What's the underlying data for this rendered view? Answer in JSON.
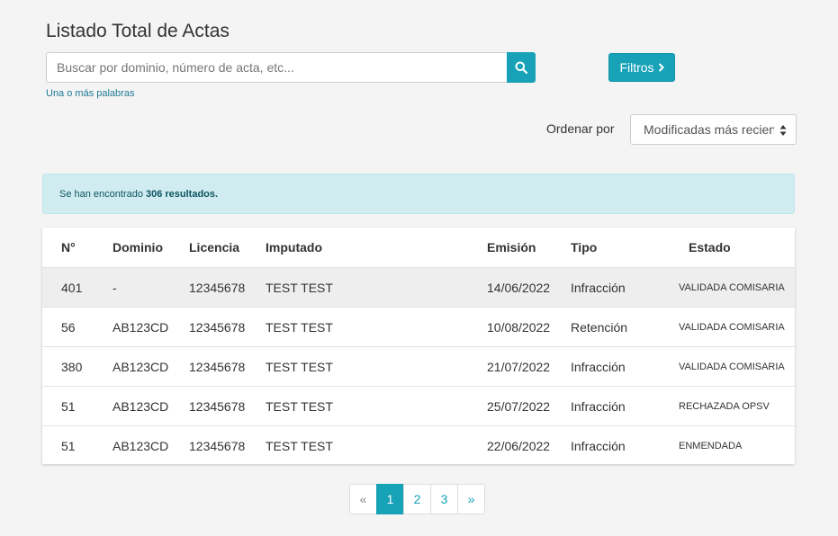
{
  "page": {
    "title": "Listado Total de Actas"
  },
  "search": {
    "placeholder": "Buscar por dominio, número de acta, etc...",
    "value": "",
    "hint": "Una o más palabras"
  },
  "filters": {
    "label": "Filtros"
  },
  "sort": {
    "label": "Ordenar por",
    "selected": "Modificadas más recientes"
  },
  "alert": {
    "prefix": "Se han encontrado",
    "count": "306 resultados."
  },
  "table": {
    "headers": {
      "n": "N°",
      "dominio": "Dominio",
      "licencia": "Licencia",
      "imputado": "Imputado",
      "emision": "Emisión",
      "tipo": "Tipo",
      "estado": "Estado"
    },
    "rows": [
      {
        "n": "401",
        "dominio": "-",
        "licencia": "12345678",
        "imputado": "TEST TEST",
        "emision": "14/06/2022",
        "tipo": "Infracción",
        "estado": "VALIDADA COMISARIA"
      },
      {
        "n": "56",
        "dominio": "AB123CD",
        "licencia": "12345678",
        "imputado": "TEST TEST",
        "emision": "10/08/2022",
        "tipo": "Retención",
        "estado": "VALIDADA COMISARIA"
      },
      {
        "n": "380",
        "dominio": "AB123CD",
        "licencia": "12345678",
        "imputado": "TEST TEST",
        "emision": "21/07/2022",
        "tipo": "Infracción",
        "estado": "VALIDADA COMISARIA"
      },
      {
        "n": "51",
        "dominio": "AB123CD",
        "licencia": "12345678",
        "imputado": "TEST TEST",
        "emision": "25/07/2022",
        "tipo": "Infracción",
        "estado": "RECHAZADA OPSV"
      },
      {
        "n": "51",
        "dominio": "AB123CD",
        "licencia": "12345678",
        "imputado": "TEST TEST",
        "emision": "22/06/2022",
        "tipo": "Infracción",
        "estado": "ENMENDADA"
      }
    ]
  },
  "pagination": {
    "prev": "«",
    "pages": [
      "1",
      "2",
      "3"
    ],
    "next": "»",
    "current": "1"
  },
  "colors": {
    "accent": "#17a2b8",
    "alert_bg": "#d1ecf1",
    "alert_text": "#0c5460",
    "background": "#f4f4f4"
  },
  "icons": {
    "search": "search-icon",
    "filters": "chevron-right-icon",
    "sort": "sort-arrows-icon"
  }
}
